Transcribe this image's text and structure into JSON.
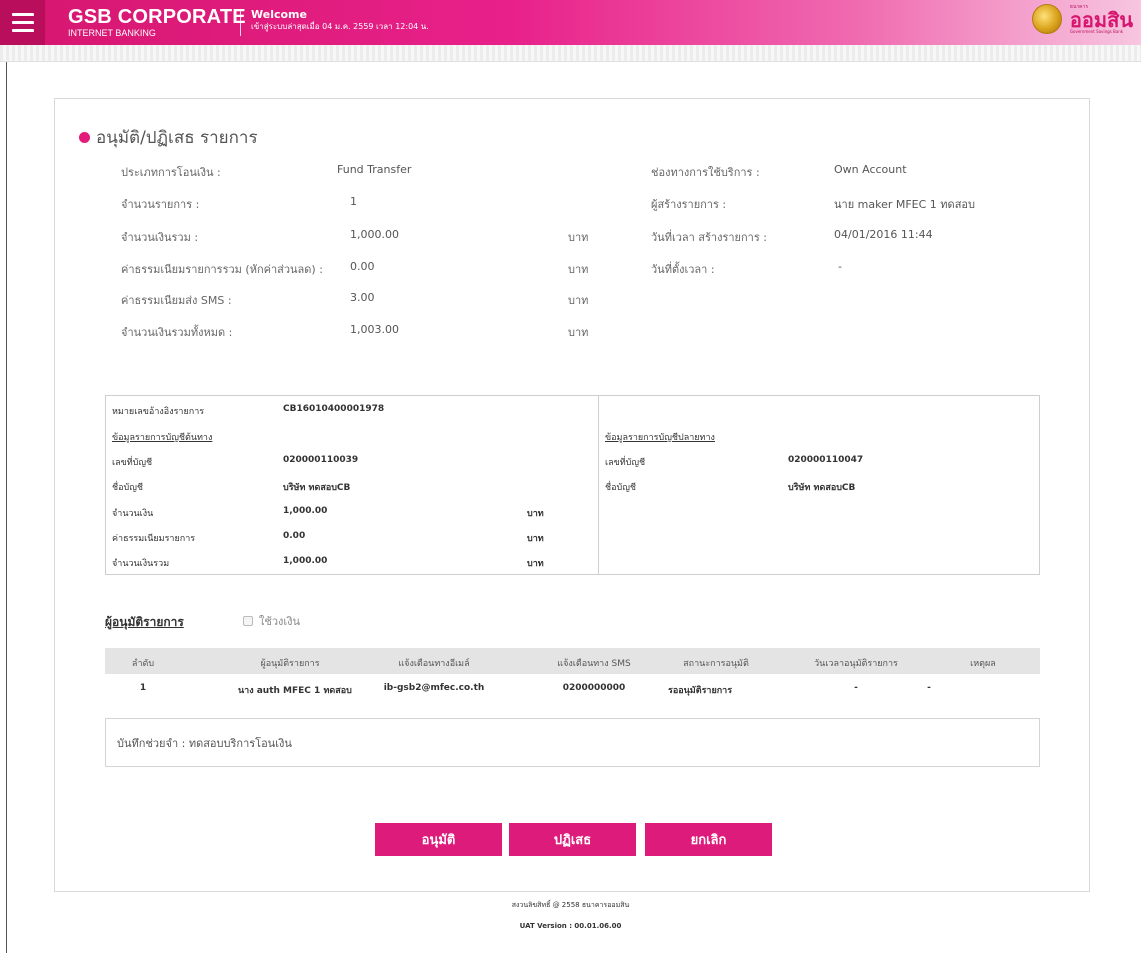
{
  "header": {
    "brand_name": "GSB CORPORATE",
    "brand_sub": "INTERNET BANKING",
    "welcome": "Welcome",
    "last_login": "เข้าสู่ระบบล่าสุดเมื่อ 04 ม.ค. 2559 เวลา 12:04 น.",
    "logo_top": "ธนาคาร",
    "logo_main": "ออมสิน",
    "logo_bottom": "Government Savings Bank"
  },
  "page": {
    "title": "อนุมัติ/ปฏิเสธ รายการ"
  },
  "summary": {
    "transfer_type_label": "ประเภทการโอนเงิน :",
    "transfer_type_value": "Fund Transfer",
    "count_label": "จำนวนรายการ :",
    "count_value": "1",
    "total_label": "จำนวนเงินรวม :",
    "total_value": "1,000.00",
    "fee_label": "ค่าธรรมเนียมรายการรวม (หักค่าส่วนลด) :",
    "fee_value": "0.00",
    "sms_fee_label": "ค่าธรรมเนียมส่ง SMS :",
    "sms_fee_value": "3.00",
    "grand_total_label": "จำนวนเงินรวมทั้งหมด :",
    "grand_total_value": "1,003.00",
    "currency": "บาท",
    "channel_label": "ช่องทางการใช้บริการ :",
    "channel_value": "Own Account",
    "creator_label": "ผู้สร้างรายการ :",
    "creator_value": "นาย maker MFEC 1 ทดสอบ",
    "created_label": "วันที่เวลา สร้างรายการ :",
    "created_value": "04/01/2016 11:44",
    "scheduled_label": "วันที่ตั้งเวลา :",
    "scheduled_value": "-"
  },
  "detail": {
    "ref_label": "หมายเลขอ้างอิงรายการ",
    "ref_value": "CB16010400001978",
    "source_title": "ข้อมูลรายการบัญชีต้นทาง",
    "dest_title": "ข้อมูลรายการบัญชีปลายทาง",
    "acct_no_label": "เลขที่บัญชี",
    "acct_name_label": "ชื่อบัญชี",
    "source_acct_no": "020000110039",
    "source_acct_name": "บริษัท ทดสอบCB",
    "dest_acct_no": "020000110047",
    "dest_acct_name": "บริษัท ทดสอบCB",
    "amount_label": "จำนวนเงิน",
    "amount_value": "1,000.00",
    "fee_label": "ค่าธรรมเนียมรายการ",
    "fee_value": "0.00",
    "total_label": "จำนวนเงินรวม",
    "total_value": "1,000.00",
    "currency": "บาท"
  },
  "approvers": {
    "title": "ผู้อนุมัติรายการ",
    "checkbox_label": "ใช้วงเงิน",
    "columns": [
      "ลำดับ",
      "ผู้อนุมัติรายการ",
      "แจ้งเตือนทางอีเมล์",
      "แจ้งเตือนทาง SMS",
      "สถานะการอนุมัติ",
      "วันเวลาอนุมัติรายการ",
      "เหตุผล"
    ],
    "row": {
      "no": "1",
      "name": "นาง auth MFEC 1 ทดสอบ",
      "email": "ib-gsb2@mfec.co.th",
      "sms": "0200000000",
      "status": "รออนุมัติรายการ",
      "datetime": "-",
      "reason": "-"
    }
  },
  "memo": {
    "text": "บันทึกช่วยจำ : ทดสอบบริการโอนเงิน"
  },
  "actions": {
    "approve": "อนุมัติ",
    "reject": "ปฏิเสธ",
    "cancel": "ยกเลิก"
  },
  "footer": {
    "copyright": "สงวนลิขสิทธิ์ @ 2558 ธนาคารออมสิน",
    "version": "UAT Version : 00.01.06.00"
  },
  "colors": {
    "brand": "#e31b7b",
    "button": "#dd1b7a"
  },
  "icons": {
    "menu": "hamburger-icon",
    "bullet": "dot-icon",
    "checkbox": "checkbox-icon"
  }
}
